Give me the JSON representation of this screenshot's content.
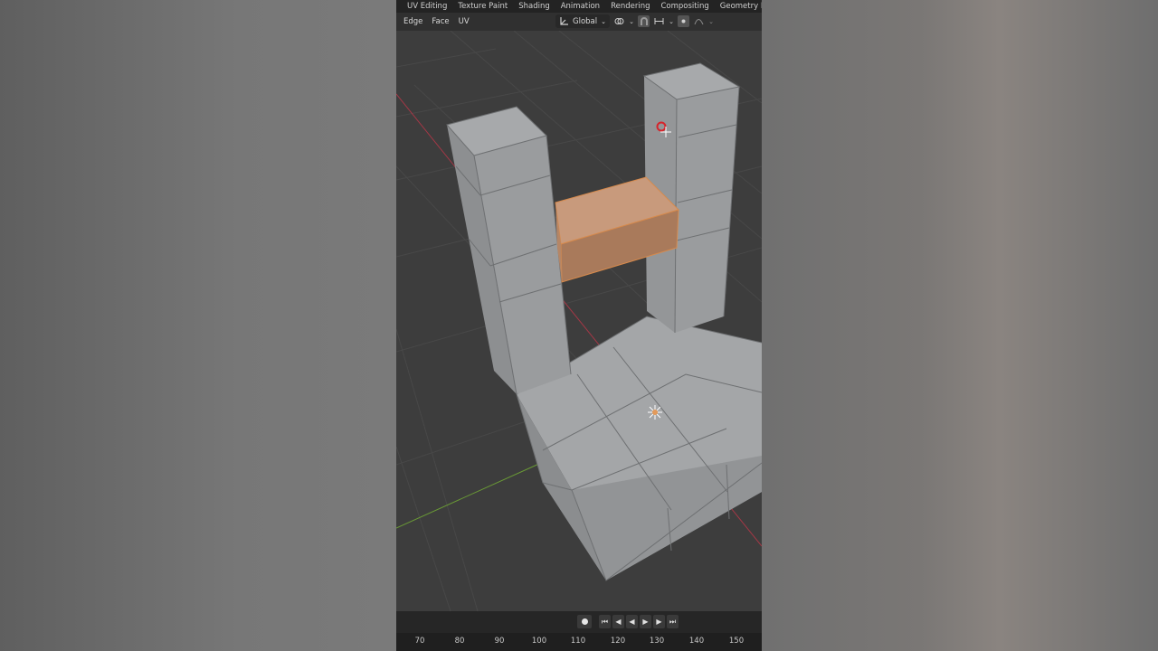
{
  "workspace_tabs": [
    "UV Editing",
    "Texture Paint",
    "Shading",
    "Animation",
    "Rendering",
    "Compositing",
    "Geometry Nodes"
  ],
  "header": {
    "menus": [
      "Edge",
      "Face",
      "UV"
    ],
    "orientation": "Global"
  },
  "icons": {
    "transform_orientation": "axis-icon",
    "pivot": "link-icon",
    "snap": "magnet-icon",
    "proportional": "proportional-icon"
  },
  "timeline": {
    "frames": [
      "70",
      "80",
      "90",
      "100",
      "110",
      "120",
      "130",
      "140",
      "150"
    ]
  },
  "colors": {
    "selected_face": "#c79270",
    "mesh": "#9a9c9e",
    "x_axis": "#b33a49",
    "y_axis": "#6f9a3a"
  }
}
